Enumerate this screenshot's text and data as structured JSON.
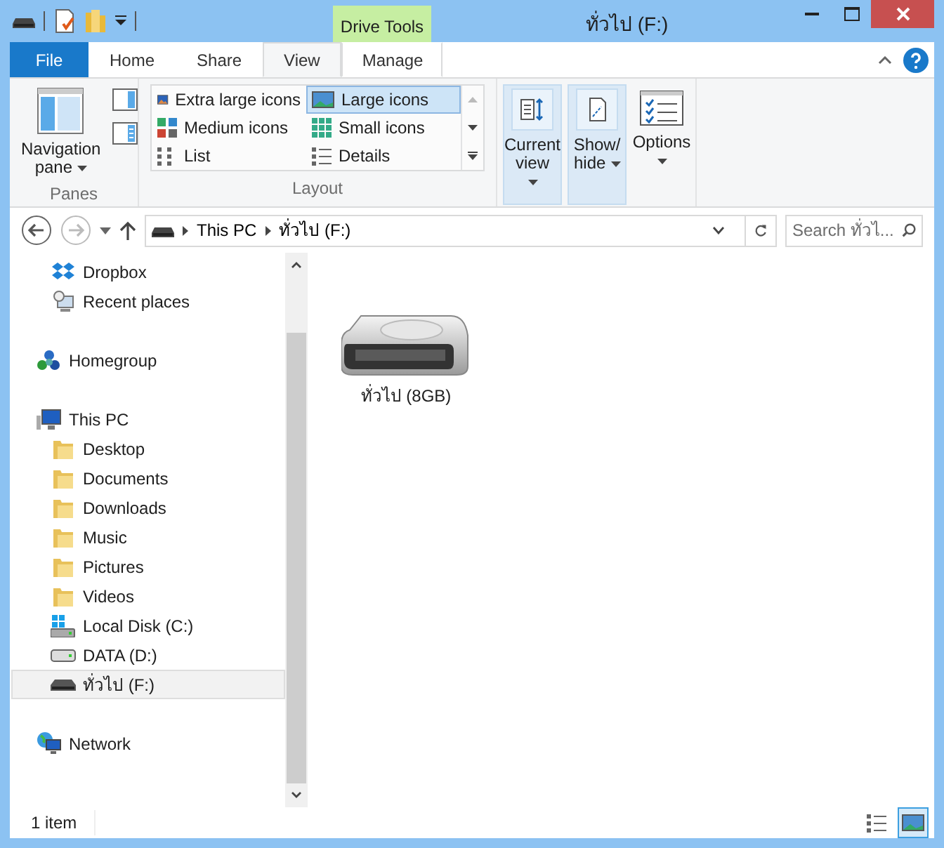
{
  "window": {
    "title": "ทั่วไป (F:)"
  },
  "contextual_group": {
    "label": "Drive Tools"
  },
  "tabs": [
    {
      "label": "File",
      "kind": "file",
      "selected": false
    },
    {
      "label": "Home",
      "kind": "normal",
      "selected": false
    },
    {
      "label": "Share",
      "kind": "normal",
      "selected": false
    },
    {
      "label": "View",
      "kind": "normal",
      "selected": true
    },
    {
      "label": "Manage",
      "kind": "contextual",
      "selected": false
    }
  ],
  "ribbon": {
    "panes": {
      "label": "Panes",
      "button": [
        "Navigation",
        "pane"
      ]
    },
    "layout": {
      "label": "Layout",
      "options": [
        {
          "label": "Extra large icons",
          "kind": "xl",
          "selected": false
        },
        {
          "label": "Large icons",
          "kind": "large",
          "selected": true
        },
        {
          "label": "Medium icons",
          "kind": "medium",
          "selected": false
        },
        {
          "label": "Small icons",
          "kind": "small",
          "selected": false
        },
        {
          "label": "List",
          "kind": "list",
          "selected": false
        },
        {
          "label": "Details",
          "kind": "details",
          "selected": false
        }
      ]
    },
    "buttons": [
      {
        "lines": [
          "Current",
          "view"
        ],
        "kind": "current",
        "highlighted": true
      },
      {
        "lines": [
          "Show/",
          "hide"
        ],
        "kind": "showhide",
        "highlighted": true
      },
      {
        "lines": [
          "Options"
        ],
        "kind": "options",
        "highlighted": false
      }
    ]
  },
  "address": {
    "segments": [
      "This PC",
      "ทั่วไป (F:)"
    ]
  },
  "search": {
    "placeholder": "Search ทั่วไ..."
  },
  "nav": [
    {
      "children": [
        {
          "label": "Dropbox",
          "kind": "dropbox",
          "selected": false
        },
        {
          "label": "Recent places",
          "kind": "recent",
          "selected": false
        }
      ]
    },
    {
      "label": "Homegroup",
      "kind": "homegroup",
      "selected": false
    },
    {
      "label": "This PC",
      "kind": "pc",
      "selected": false,
      "children": [
        {
          "label": "Desktop",
          "kind": "folder",
          "selected": false
        },
        {
          "label": "Documents",
          "kind": "folder",
          "selected": false
        },
        {
          "label": "Downloads",
          "kind": "folder",
          "selected": false
        },
        {
          "label": "Music",
          "kind": "folder",
          "selected": false
        },
        {
          "label": "Pictures",
          "kind": "folder",
          "selected": false
        },
        {
          "label": "Videos",
          "kind": "folder",
          "selected": false
        },
        {
          "label": "Local Disk (C:)",
          "kind": "sysdisk",
          "selected": false
        },
        {
          "label": "DATA (D:)",
          "kind": "disk",
          "selected": false
        },
        {
          "label": "ทั่วไป (F:)",
          "kind": "usb",
          "selected": true
        }
      ]
    },
    {
      "label": "Network",
      "kind": "network",
      "selected": false
    }
  ],
  "content": [
    {
      "label": "ทั่วไป (8GB)",
      "selected": false
    }
  ],
  "status_bar": {
    "text": "1 item",
    "views": [
      {
        "kind": "details",
        "selected": false
      },
      {
        "kind": "large",
        "selected": true
      }
    ]
  }
}
